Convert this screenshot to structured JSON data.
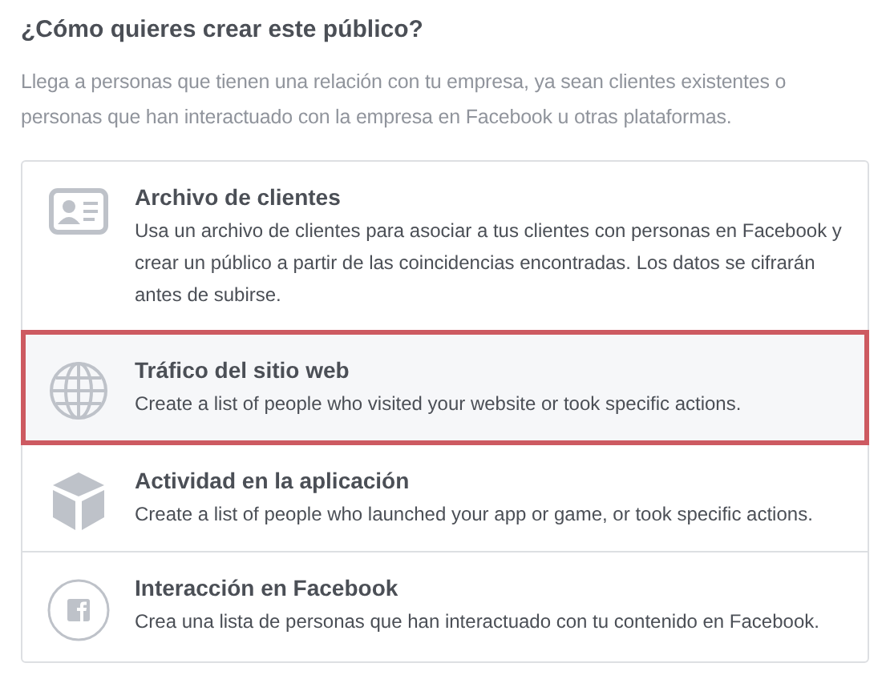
{
  "heading": "¿Cómo quieres crear este público?",
  "intro": "Llega a personas que tienen una relación con tu empresa, ya sean clientes existentes o personas que han interactuado con la empresa en Facebook u otras plataformas.",
  "options": [
    {
      "kind": "card",
      "title": "Archivo de clientes",
      "description": "Usa un archivo de clientes para asociar a tus clientes con personas en Facebook y crear un público a partir de las coincidencias encontradas. Los datos se cifrarán antes de subirse.",
      "selected": false
    },
    {
      "kind": "globe",
      "title": "Tráfico del sitio web",
      "description": "Create a list of people who visited your website or took specific actions.",
      "selected": true
    },
    {
      "kind": "cube",
      "title": "Actividad en la aplicación",
      "description": "Create a list of people who launched your app or game, or took specific actions.",
      "selected": false
    },
    {
      "kind": "facebook",
      "title": "Interacción en Facebook",
      "description": "Crea una lista de personas que han interactuado con tu contenido en Facebook.",
      "selected": false
    }
  ]
}
